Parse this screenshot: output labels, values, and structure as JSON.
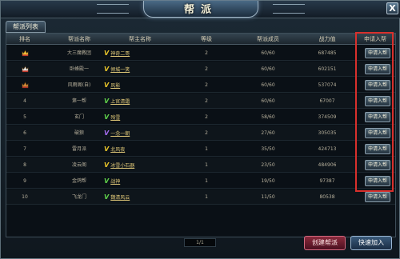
{
  "window": {
    "title": "帮派",
    "close_label": "X"
  },
  "tab": {
    "label": "帮派列表"
  },
  "columns": [
    "排名",
    "帮派名称",
    "帮主名称",
    "等级",
    "帮派成员",
    "战力值",
    "申请入帮"
  ],
  "rows": [
    {
      "rank": "",
      "rank_icon": "gold-crown-icon",
      "guild": "大三魔教团",
      "vip": "gold",
      "leader": "神奇二哥",
      "level": "2",
      "members": "60/60",
      "power": "687485",
      "action": "申请入帮"
    },
    {
      "rank": "",
      "rank_icon": "silver-crown-icon",
      "guild": "卧蜂殿一",
      "vip": "gold",
      "leader": "倾城一笑",
      "level": "2",
      "members": "60/60",
      "power": "602151",
      "action": "申请入帮"
    },
    {
      "rank": "",
      "rank_icon": "bronze-crown-icon",
      "guild": "风雨阁(自)",
      "vip": "gold",
      "leader": "风影",
      "level": "2",
      "members": "60/60",
      "power": "537074",
      "action": "申请入帮"
    },
    {
      "rank": "4",
      "rank_icon": "",
      "guild": "第一帮",
      "vip": "green",
      "leader": "上官清霜",
      "level": "2",
      "members": "60/60",
      "power": "67007",
      "action": "申请入帮"
    },
    {
      "rank": "5",
      "rank_icon": "",
      "guild": "玄门",
      "vip": "green",
      "leader": "残雪",
      "level": "2",
      "members": "58/60",
      "power": "374509",
      "action": "申请入帮"
    },
    {
      "rank": "6",
      "rank_icon": "",
      "guild": "破狼",
      "vip": "purple",
      "leader": "一念一朝",
      "level": "2",
      "members": "27/60",
      "power": "305035",
      "action": "申请入帮"
    },
    {
      "rank": "7",
      "rank_icon": "",
      "guild": "雷月派",
      "vip": "gold",
      "leader": "北风夜",
      "level": "1",
      "members": "35/50",
      "power": "424713",
      "action": "申请入帮"
    },
    {
      "rank": "8",
      "rank_icon": "",
      "guild": "凌云阁",
      "vip": "gold",
      "leader": "冰雪小石器",
      "level": "1",
      "members": "23/50",
      "power": "484906",
      "action": "申请入帮"
    },
    {
      "rank": "9",
      "rank_icon": "",
      "guild": "金鸽帮",
      "vip": "green",
      "leader": "战神",
      "level": "1",
      "members": "19/50",
      "power": "97387",
      "action": "申请入帮"
    },
    {
      "rank": "10",
      "rank_icon": "",
      "guild": "飞龙门",
      "vip": "green",
      "leader": "魏清风云",
      "level": "1",
      "members": "11/50",
      "power": "80538",
      "action": "申请入帮"
    }
  ],
  "pager": {
    "text": "1/1"
  },
  "footer": {
    "create_label": "创建帮派",
    "join_label": "快速加入"
  },
  "colors": {
    "highlight": "#d8302c",
    "vip_gold": "#e8c42a",
    "vip_green": "#5fd14a",
    "vip_purple": "#a66df0"
  }
}
